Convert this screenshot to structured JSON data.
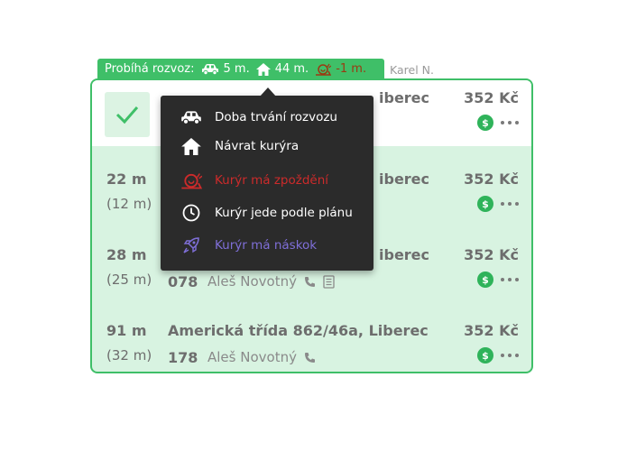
{
  "status": {
    "label": "Probíhá rozvoz:",
    "trip_time": "5 m.",
    "return_time": "44 m.",
    "delay": "-1 m.",
    "user": "Karel N."
  },
  "tooltip": {
    "items": [
      {
        "icon": "car-icon",
        "label": "Doba trvání rozvozu"
      },
      {
        "icon": "house-icon",
        "label": "Návrat kurýra"
      },
      {
        "icon": "snail-icon",
        "label": "Kurýr má zpoždění"
      },
      {
        "icon": "clock-icon",
        "label": "Kurýr jede podle plánu"
      },
      {
        "icon": "rocket-icon",
        "label": "Kurýr má náskok"
      }
    ]
  },
  "orders": [
    {
      "address_partial": "iberec",
      "price": "352 Kč"
    },
    {
      "distance": "22 m",
      "time": "(12 m)",
      "address_partial": "iberec",
      "price": "352 Kč"
    },
    {
      "distance": "28 m",
      "time": "(25 m)",
      "address_partial": "iberec",
      "order_no": "078",
      "driver": "Aleš Novotný",
      "price": "352 Kč"
    },
    {
      "distance": "91 m",
      "time": "(32 m)",
      "address": "Americká třída 862/46a, Liberec",
      "order_no": "178",
      "driver": "Aleš Novotný",
      "price": "352 Kč"
    }
  ],
  "colors": {
    "accent_green": "#3fbf68",
    "row_background": "#d8f3e1",
    "tooltip_background": "#2b2b2b",
    "late_red": "#cc2b2b",
    "ahead_purple": "#7f6fd8"
  }
}
